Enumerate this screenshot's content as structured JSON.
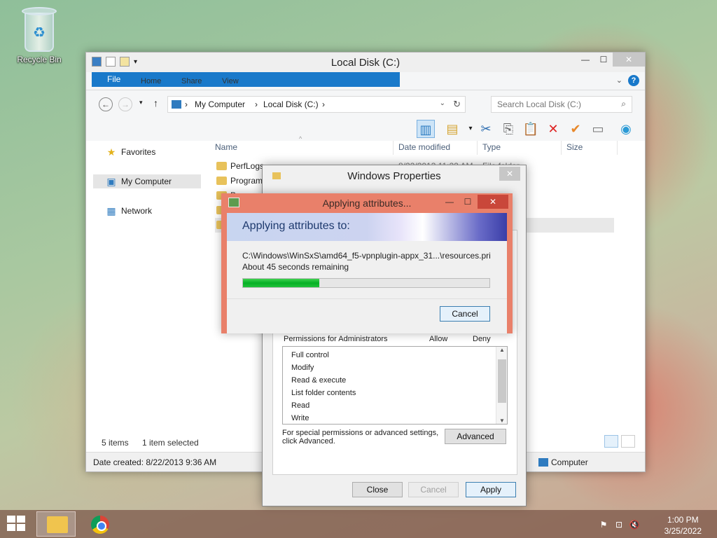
{
  "desktop": {
    "recycle_bin_label": "Recycle Bin"
  },
  "explorer": {
    "title": "Local Disk (C:)",
    "tabs": [
      "File",
      "Home",
      "Share",
      "View"
    ],
    "breadcrumb": [
      "My Computer",
      "Local Disk (C:)"
    ],
    "search_placeholder": "Search Local Disk (C:)",
    "sidebar": [
      "Favorites",
      "My Computer",
      "Network"
    ],
    "columns": [
      "Name",
      "Date modified",
      "Type",
      "Size"
    ],
    "files": [
      {
        "name": "PerfLogs",
        "date": "8/22/2013 11:22 AM",
        "type": "File folder"
      },
      {
        "name": "Program",
        "date": "",
        "type": ""
      },
      {
        "name": "P",
        "date": "",
        "type": ""
      },
      {
        "name": "",
        "date": "",
        "type": ""
      }
    ],
    "status_items": "5 items",
    "status_selected": "1 item selected",
    "details_created": "Date created: 8/22/2013 9:36 AM",
    "details_location": "Computer"
  },
  "properties": {
    "title": "Windows Properties",
    "perm_header": "Permissions for Administrators",
    "allow": "Allow",
    "deny": "Deny",
    "permissions": [
      "Full control",
      "Modify",
      "Read & execute",
      "List folder contents",
      "Read",
      "Write"
    ],
    "special_text": "For special permissions or advanced settings, click Advanced.",
    "advanced_btn": "Advanced",
    "close_btn": "Close",
    "cancel_btn": "Cancel",
    "apply_btn": "Apply"
  },
  "apply_dialog": {
    "title": "Applying attributes...",
    "banner": "Applying attributes to:",
    "path": "C:\\Windows\\WinSxS\\amd64_f5-vpnplugin-appx_31...\\resources.pri",
    "remaining": "About 45 seconds remaining",
    "progress": 0.31,
    "cancel_btn": "Cancel",
    "progress_color": "#06b025"
  },
  "taskbar": {
    "time": "1:00 PM",
    "date": "3/25/2022"
  }
}
